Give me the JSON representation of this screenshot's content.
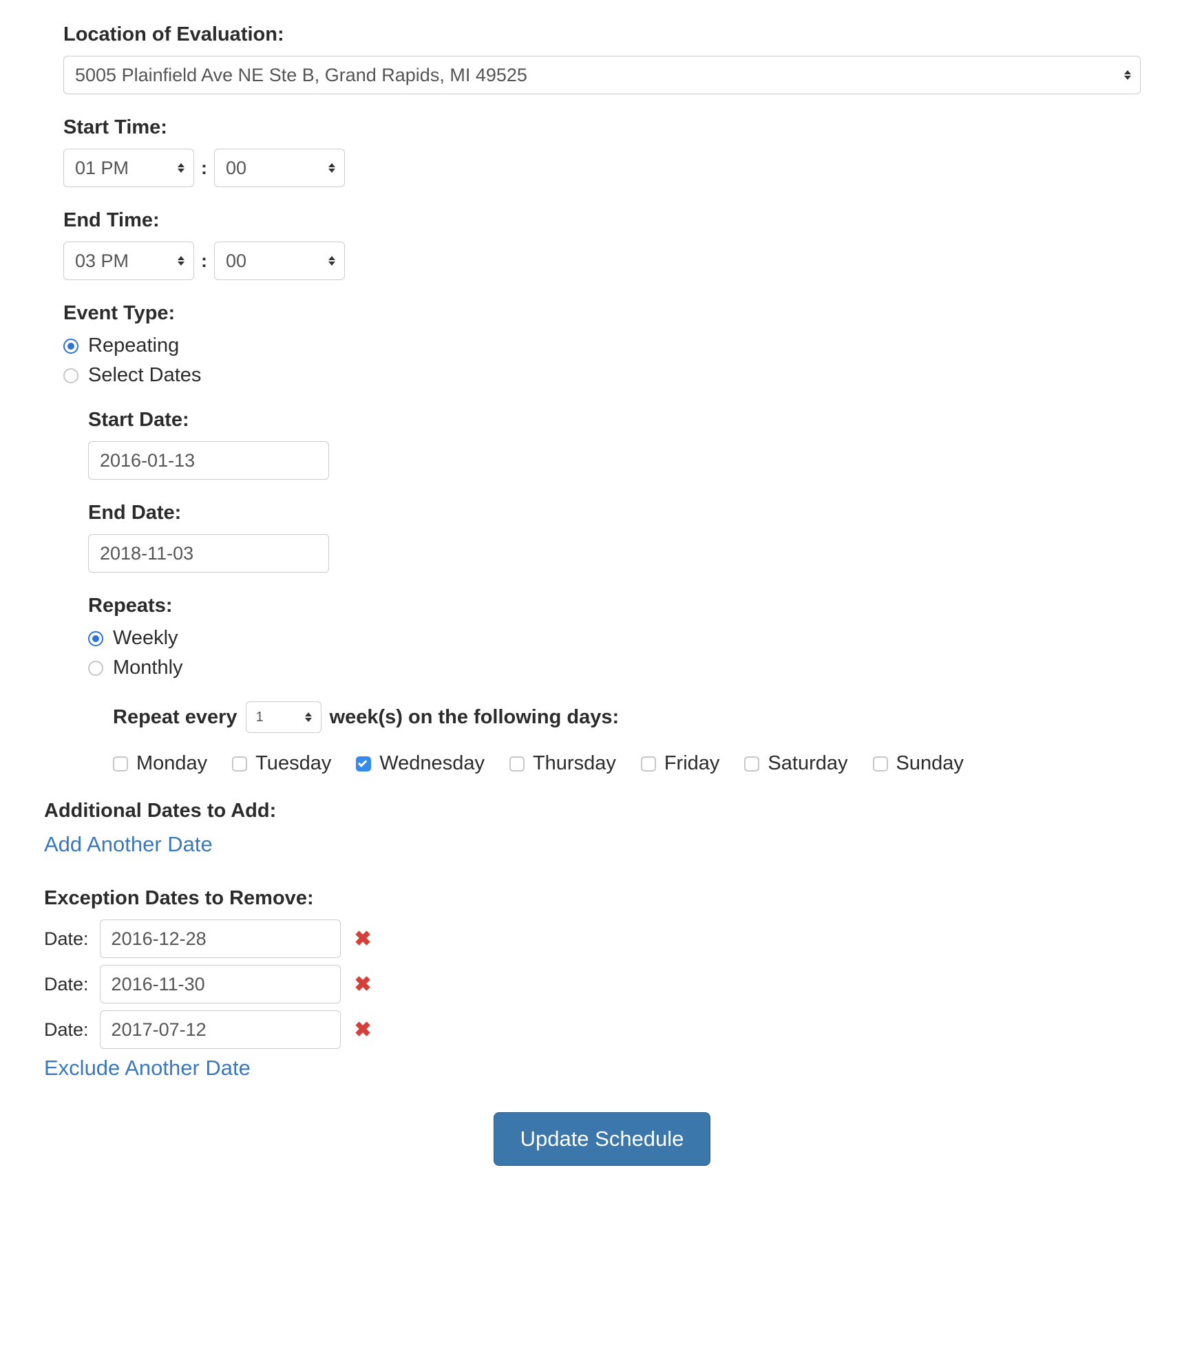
{
  "location": {
    "label": "Location of Evaluation:",
    "selected": "5005 Plainfield Ave NE Ste B, Grand Rapids, MI 49525"
  },
  "start_time": {
    "label": "Start Time:",
    "hour": "01 PM",
    "minute": "00"
  },
  "end_time": {
    "label": "End Time:",
    "hour": "03 PM",
    "minute": "00"
  },
  "event_type": {
    "label": "Event Type:",
    "options": {
      "repeating": "Repeating",
      "select_dates": "Select Dates"
    },
    "selected": "repeating"
  },
  "repeat": {
    "start_date": {
      "label": "Start Date:",
      "value": "2016-01-13"
    },
    "end_date": {
      "label": "End Date:",
      "value": "2018-11-03"
    },
    "repeats_label": "Repeats:",
    "freq_options": {
      "weekly": "Weekly",
      "monthly": "Monthly"
    },
    "freq_selected": "weekly",
    "every": {
      "prefix": "Repeat every",
      "value": "1",
      "suffix": "week(s) on the following days:"
    },
    "days": [
      {
        "name": "Monday",
        "checked": false
      },
      {
        "name": "Tuesday",
        "checked": false
      },
      {
        "name": "Wednesday",
        "checked": true
      },
      {
        "name": "Thursday",
        "checked": false
      },
      {
        "name": "Friday",
        "checked": false
      },
      {
        "name": "Saturday",
        "checked": false
      },
      {
        "name": "Sunday",
        "checked": false
      }
    ]
  },
  "additional": {
    "label": "Additional Dates to Add:",
    "add_link": "Add Another Date"
  },
  "exceptions": {
    "label": "Exception Dates to Remove:",
    "row_label": "Date:",
    "dates": [
      "2016-12-28",
      "2016-11-30",
      "2017-07-12"
    ],
    "exclude_link": "Exclude Another Date"
  },
  "submit": {
    "label": "Update Schedule"
  },
  "colors": {
    "accent": "#358af0",
    "link": "#3a77bd",
    "danger": "#d43f3a",
    "button": "#3b77ab"
  }
}
